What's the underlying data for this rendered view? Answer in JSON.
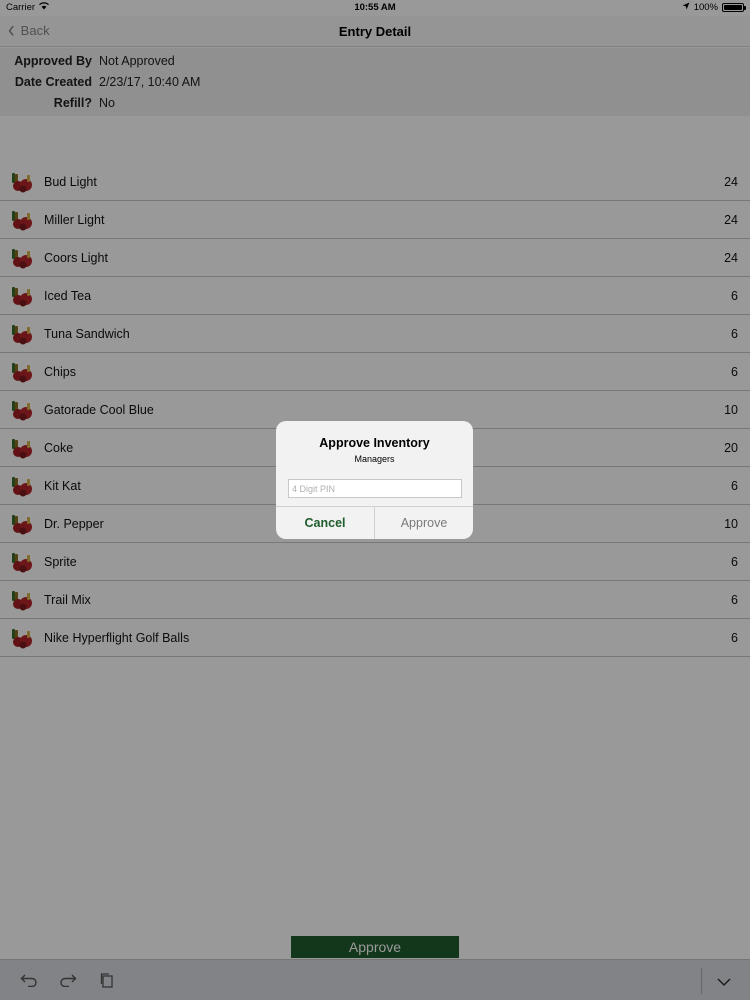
{
  "status_bar": {
    "carrier": "Carrier",
    "time": "10:55 AM",
    "battery": "100%",
    "battery_level": 1.0
  },
  "nav": {
    "back_label": "Back",
    "title": "Entry Detail"
  },
  "info": {
    "approved_by_label": "Approved By",
    "approved_by_value": "Not Approved",
    "date_created_label": "Date Created",
    "date_created_value": "2/23/17, 10:40 AM",
    "refill_label": "Refill?",
    "refill_value": "No"
  },
  "items": [
    {
      "name": "Bud Light",
      "qty": "24"
    },
    {
      "name": "Miller Light",
      "qty": "24"
    },
    {
      "name": "Coors Light",
      "qty": "24"
    },
    {
      "name": "Iced Tea",
      "qty": "6"
    },
    {
      "name": "Tuna Sandwich",
      "qty": "6"
    },
    {
      "name": "Chips",
      "qty": "6"
    },
    {
      "name": "Gatorade Cool Blue",
      "qty": "10"
    },
    {
      "name": "Coke",
      "qty": "20"
    },
    {
      "name": "Kit Kat",
      "qty": "6"
    },
    {
      "name": "Dr. Pepper",
      "qty": "10"
    },
    {
      "name": "Sprite",
      "qty": "6"
    },
    {
      "name": "Trail Mix",
      "qty": "6"
    },
    {
      "name": "Nike Hyperflight Golf Balls",
      "qty": "6"
    }
  ],
  "approve_button": "Approve",
  "dialog": {
    "title": "Approve Inventory",
    "message": "Managers",
    "pin_placeholder": "4 Digit PIN",
    "cancel_label": "Cancel",
    "approve_label": "Approve"
  },
  "colors": {
    "brand_green": "#1e5c2c"
  }
}
